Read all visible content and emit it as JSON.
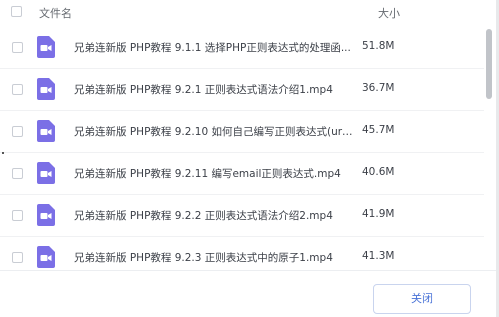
{
  "header": {
    "name_label": "文件名",
    "size_label": "大小"
  },
  "files": [
    {
      "name": "兄弟连新版 PHP教程 9.1.1 选择PHP正则表达式的处理函...",
      "size": "51.8M",
      "icon": "video-file-icon"
    },
    {
      "name": "兄弟连新版 PHP教程 9.2.1 正则表达式语法介绍1.mp4",
      "size": "36.7M",
      "icon": "video-file-icon"
    },
    {
      "name": "兄弟连新版 PHP教程 9.2.10 如何自己编写正则表达式(url...",
      "size": "45.7M",
      "icon": "video-file-icon"
    },
    {
      "name": "兄弟连新版 PHP教程 9.2.11 编写email正则表达式.mp4",
      "size": "40.6M",
      "icon": "video-file-icon"
    },
    {
      "name": "兄弟连新版 PHP教程 9.2.2 正则表达式语法介绍2.mp4",
      "size": "41.9M",
      "icon": "video-file-icon"
    },
    {
      "name": "兄弟连新版 PHP教程 9.2.3 正则表达式中的原子1.mp4",
      "size": "41.3M",
      "icon": "video-file-icon"
    }
  ],
  "footer": {
    "close_label": "关闭"
  },
  "colors": {
    "icon_purple": "#7b6fe6",
    "accent_blue": "#4a73d7"
  }
}
